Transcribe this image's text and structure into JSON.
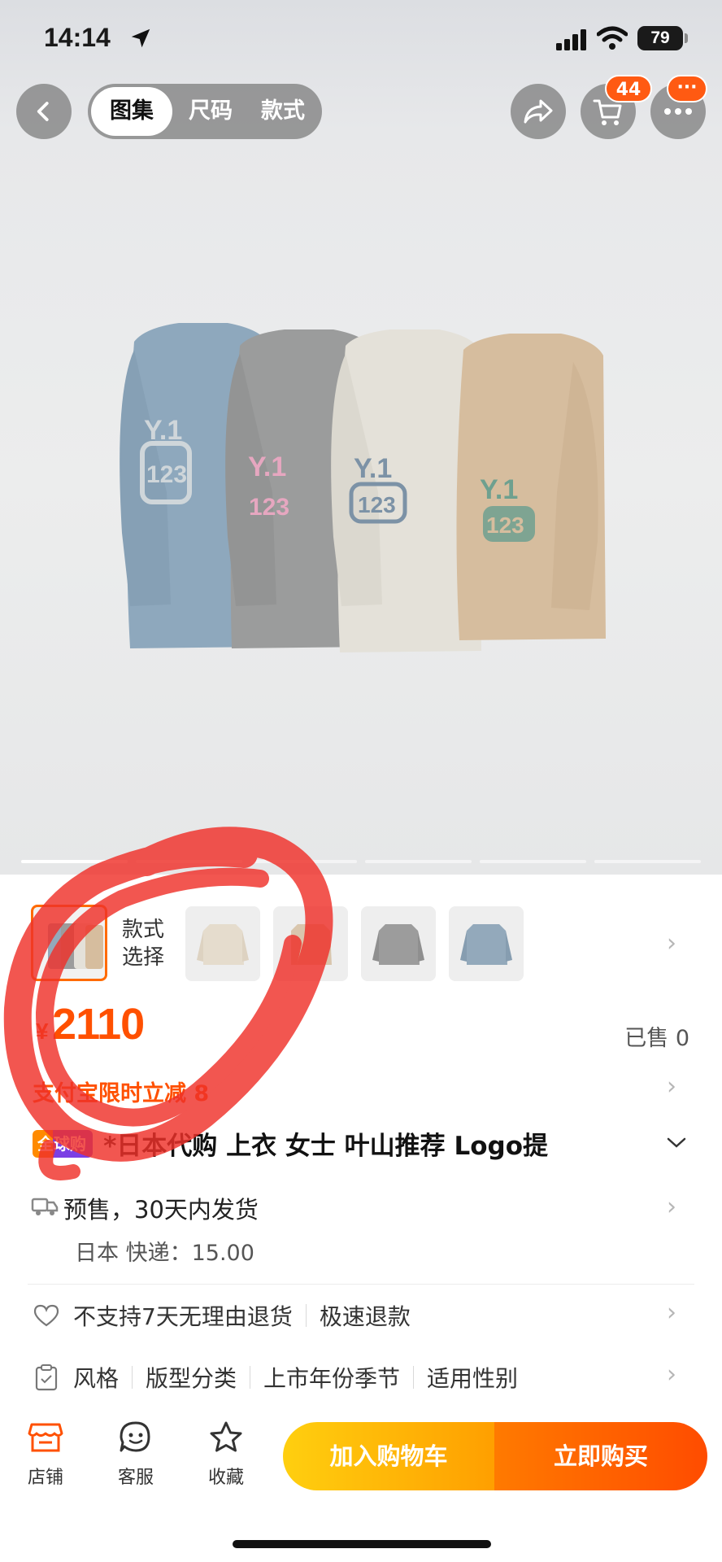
{
  "status_bar": {
    "time": "14:14",
    "battery": "79"
  },
  "nav": {
    "tabs": [
      "图集",
      "尺码",
      "款式"
    ],
    "active_tab": "图集",
    "cart_count": "44",
    "more_badge": "···"
  },
  "gallery": {
    "image_count": 6,
    "current_index": 1,
    "shirts": [
      {
        "color": "#8ea8bd",
        "print": "#cfd6da"
      },
      {
        "color": "#9b9c9c",
        "print": "#e6a7c0"
      },
      {
        "color": "#e4e1d9",
        "print": "#7c92a6"
      },
      {
        "color": "#d6bd9e",
        "print": "#6ea08f"
      }
    ]
  },
  "style_picker": {
    "label": "款式\n选择",
    "thumb_colors": [
      "#d7cdbf",
      "#e5dccd",
      "#d9c6ad",
      "#9c9c9c",
      "#93a9bb"
    ]
  },
  "product": {
    "currency": "¥",
    "price": "2110",
    "sold": "已售 0",
    "promo": "支付宝限时立减 8",
    "global_tag": "全球购",
    "title": "*日本代购 上衣 女士 叶山推荐 Logo提"
  },
  "shipping": {
    "line1": "预售，30天内发货",
    "line2": "日本  快递：15.00"
  },
  "services": {
    "returns": "不支持7天无理由退货",
    "refund": "极速退款"
  },
  "params": [
    "风格",
    "版型分类",
    "上市年份季节",
    "适用性别"
  ],
  "bottom_bar": {
    "store": "店铺",
    "service": "客服",
    "favorite": "收藏",
    "add_to_cart": "加入购物车",
    "buy_now": "立即购买"
  },
  "colors": {
    "accent": "#ff5000",
    "scribble": "#f0312a"
  }
}
